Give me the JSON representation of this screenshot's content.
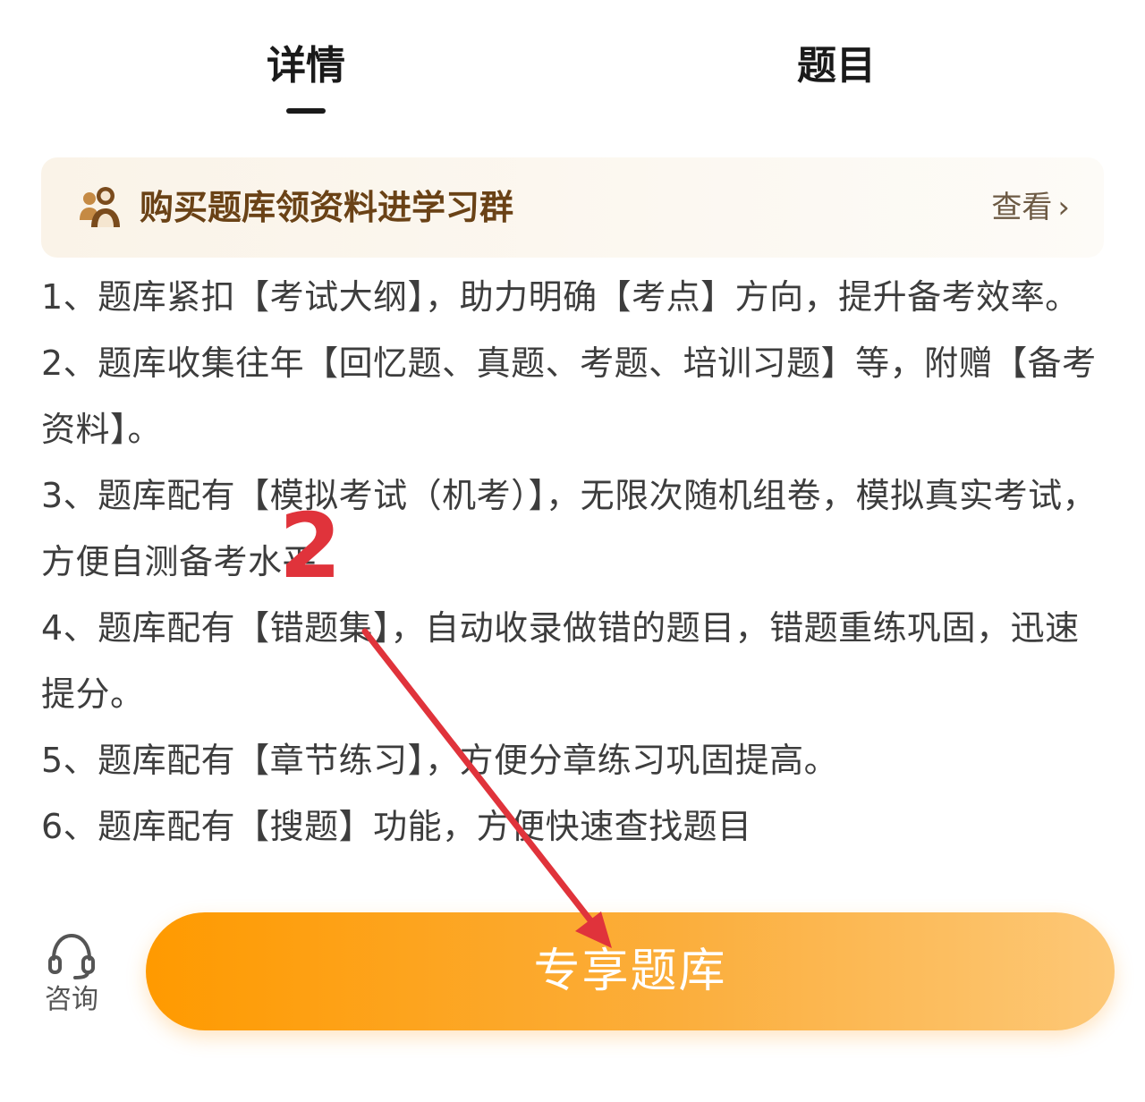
{
  "tabs": [
    {
      "label": "详情",
      "active": true
    },
    {
      "label": "题目",
      "active": false
    }
  ],
  "banner": {
    "icon": "group-users-icon",
    "title": "购买题库领资料进学习群",
    "link_label": "查看",
    "link_chevron": "›"
  },
  "content": {
    "paragraphs": [
      "1、题库紧扣【考试大纲】，助力明确【考点】方向，提升备考效率。",
      "2、题库收集往年【回忆题、真题、考题、培训习题】等，附赠【备考资料】。",
      "3、题库配有【模拟考试（机考）】，无限次随机组卷，模拟真实考试，方便自测备考水平",
      "4、题库配有【错题集】，自动收录做错的题目，错题重练巩固，迅速提分。",
      "5、题库配有【章节练习】，方便分章练习巩固提高。",
      "6、题库配有【搜题】功能，方便快速查找题目"
    ]
  },
  "bottom_bar": {
    "consult_icon": "headset-icon",
    "consult_label": "咨询",
    "cta_label": "专享题库"
  },
  "annotation": {
    "step_number": "2",
    "color": "#e0333b"
  },
  "colors": {
    "cta_start": "#ff9a00",
    "cta_end": "#fdc877",
    "banner_text": "#6a4216"
  }
}
